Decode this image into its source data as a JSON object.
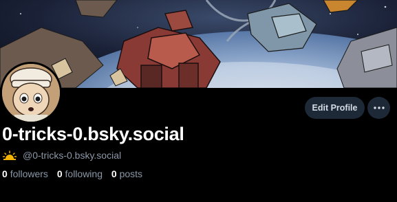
{
  "profile": {
    "display_name": "0-tricks-0.bsky.social",
    "handle": "@0-tricks-0.bsky.social",
    "handle_emoji": "sunrise-emoji-icon"
  },
  "actions": {
    "edit_profile_label": "Edit Profile",
    "more_icon": "ellipsis-icon"
  },
  "stats": {
    "followers_count": "0",
    "followers_label": "followers",
    "following_count": "0",
    "following_label": "following",
    "posts_count": "0",
    "posts_label": "posts"
  },
  "colors": {
    "background": "#000000",
    "button_bg": "#1e2937",
    "muted_text": "#8b98a8",
    "primary_text": "#ffffff"
  }
}
